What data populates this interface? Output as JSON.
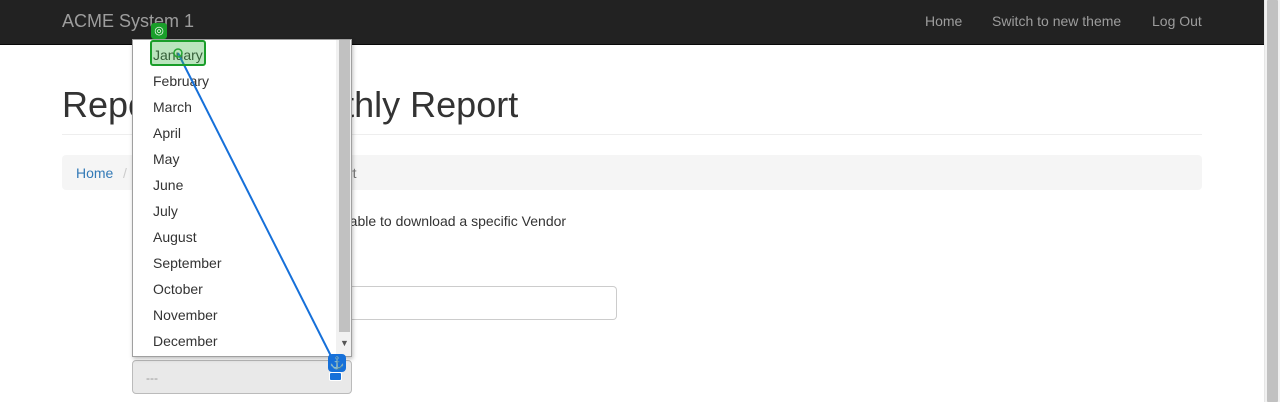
{
  "navbar": {
    "brand": "ACME System 1",
    "links": [
      "Home",
      "Switch to new theme",
      "Log Out"
    ]
  },
  "page": {
    "title_left": "Repo",
    "title_right": "ad Monthly Report"
  },
  "breadcrumb": {
    "home": "Home",
    "separator": "/",
    "tail": "rt"
  },
  "content": {
    "description_fragment": "e able to download a specific Vendor"
  },
  "select": {
    "placeholder": "---"
  },
  "dropdown": {
    "options": [
      "January",
      "February",
      "March",
      "April",
      "May",
      "June",
      "July",
      "August",
      "September",
      "October",
      "November",
      "December"
    ],
    "highlighted": "January"
  },
  "colors": {
    "navbar_bg": "#222222",
    "link": "#337ab7",
    "highlight": "#1a9e2a",
    "connector": "#1670d9"
  },
  "icons": {
    "target": "target-icon",
    "anchor": "anchor-icon"
  }
}
